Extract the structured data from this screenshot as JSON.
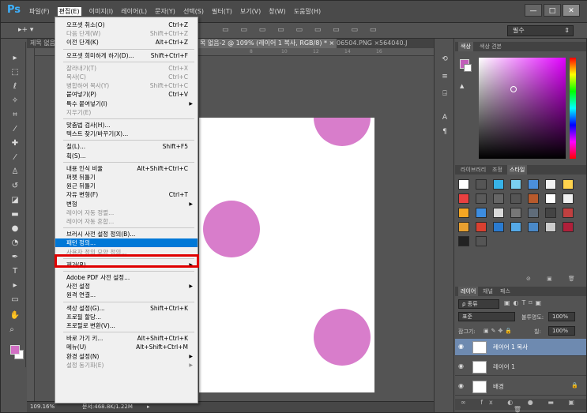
{
  "app": {
    "logo": "Ps"
  },
  "menubar": {
    "items": [
      "파일(F)",
      "편집(E)",
      "이미지(I)",
      "레이어(L)",
      "문자(Y)",
      "선택(S)",
      "필터(T)",
      "보기(V)",
      "창(W)",
      "도움말(H)"
    ],
    "active_index": 1
  },
  "window_buttons": {
    "minimize": "—",
    "maximize": "□",
    "close": "✕"
  },
  "options_bar": {
    "workspace": "필수"
  },
  "doc_tabs": [
    {
      "label": "제목 없음",
      "active": false
    },
    {
      "label": "목 없음-2 @ 109% (레이어 1 복사, RGB/8) * ×",
      "active": true
    },
    {
      "label": "06504.PNG ×",
      "active": false
    },
    {
      "label": "564040.J",
      "active": false
    }
  ],
  "ruler_ticks": [
    "8",
    "10",
    "12",
    "14",
    "16"
  ],
  "edit_menu": [
    {
      "label": "오프셋 취소(O)",
      "shortcut": "Ctrl+Z",
      "disabled": false
    },
    {
      "label": "다음 단계(W)",
      "shortcut": "Shift+Ctrl+Z",
      "disabled": true
    },
    {
      "label": "이전 단계(K)",
      "shortcut": "Alt+Ctrl+Z",
      "disabled": false
    },
    {
      "sep": true
    },
    {
      "label": "오프셋 희미하게 하기(D)...",
      "shortcut": "Shift+Ctrl+F",
      "disabled": false
    },
    {
      "sep": true
    },
    {
      "label": "잘라내기(T)",
      "shortcut": "Ctrl+X",
      "disabled": true
    },
    {
      "label": "복사(C)",
      "shortcut": "Ctrl+C",
      "disabled": true
    },
    {
      "label": "병합하여 복사(Y)",
      "shortcut": "Shift+Ctrl+C",
      "disabled": true
    },
    {
      "label": "붙여넣기(P)",
      "shortcut": "Ctrl+V",
      "disabled": false
    },
    {
      "label": "특수 붙여넣기(I)",
      "shortcut": "",
      "disabled": false,
      "submenu": true
    },
    {
      "label": "지우기(E)",
      "shortcut": "",
      "disabled": true
    },
    {
      "sep": true
    },
    {
      "label": "맞춤법 검사(H)...",
      "shortcut": "",
      "disabled": false
    },
    {
      "label": "텍스트 찾기/바꾸기(X)...",
      "shortcut": "",
      "disabled": false
    },
    {
      "sep": true
    },
    {
      "label": "칠(L)...",
      "shortcut": "Shift+F5",
      "disabled": false
    },
    {
      "label": "획(S)...",
      "shortcut": "",
      "disabled": false
    },
    {
      "sep": true
    },
    {
      "label": "내용 인식 비율",
      "shortcut": "Alt+Shift+Ctrl+C",
      "disabled": false
    },
    {
      "label": "퍼펫 뒤틀기",
      "shortcut": "",
      "disabled": false
    },
    {
      "label": "원근 뒤틀기",
      "shortcut": "",
      "disabled": false
    },
    {
      "label": "자유 변형(F)",
      "shortcut": "Ctrl+T",
      "disabled": false
    },
    {
      "label": "변형",
      "shortcut": "",
      "disabled": false,
      "submenu": true
    },
    {
      "label": "레이어 자동 정렬...",
      "shortcut": "",
      "disabled": true
    },
    {
      "label": "레이어 자동 혼합...",
      "shortcut": "",
      "disabled": true
    },
    {
      "sep": true
    },
    {
      "label": "브러시 사전 설정 정의(B)...",
      "shortcut": "",
      "disabled": false
    },
    {
      "label": "패턴 정의...",
      "shortcut": "",
      "disabled": false,
      "highlight": true
    },
    {
      "label": "사용자 정의 모양 정의...",
      "shortcut": "",
      "disabled": true
    },
    {
      "sep": true
    },
    {
      "label": "제거(R)",
      "shortcut": "",
      "disabled": false,
      "submenu": true
    },
    {
      "sep": true
    },
    {
      "label": "Adobe PDF 사전 설정...",
      "shortcut": "",
      "disabled": false
    },
    {
      "label": "사전 설정",
      "shortcut": "",
      "disabled": false,
      "submenu": true
    },
    {
      "label": "원격 연결...",
      "shortcut": "",
      "disabled": false
    },
    {
      "sep": true
    },
    {
      "label": "색상 설정(G)...",
      "shortcut": "Shift+Ctrl+K",
      "disabled": false
    },
    {
      "label": "프로필 할당...",
      "shortcut": "",
      "disabled": false
    },
    {
      "label": "프로필로 변환(V)...",
      "shortcut": "",
      "disabled": false
    },
    {
      "sep": true
    },
    {
      "label": "바로 가기 키...",
      "shortcut": "Alt+Shift+Ctrl+K",
      "disabled": false
    },
    {
      "label": "메뉴(U)",
      "shortcut": "Alt+Shift+Ctrl+M",
      "disabled": false
    },
    {
      "label": "환경 설정(N)",
      "shortcut": "",
      "disabled": false,
      "submenu": true
    },
    {
      "label": "설정 동기화(E)",
      "shortcut": "",
      "disabled": true,
      "submenu": true
    }
  ],
  "status": {
    "zoom": "109.16%",
    "doc_info": "문서:468.8K/1.22M"
  },
  "color_panel": {
    "tabs": [
      "색상",
      "색상 견본"
    ],
    "fg_color": "#c15fb9"
  },
  "styles_panel": {
    "tabs": [
      "라이브러리",
      "조정",
      "스타일"
    ],
    "swatches": [
      "#fff",
      "#555",
      "#37b3e8",
      "#7ad0f0",
      "#4b8fdb",
      "#f2f2f2",
      "#ffd34d",
      "#e94040",
      "#5a5a5a",
      "#666",
      "#555",
      "#b85a2c",
      "#ffffff",
      "#f0f0f0",
      "#f5a623",
      "#3d8de0",
      "#d9d9d9",
      "#777",
      "#5f6c7a",
      "#444",
      "#c04040",
      "#e8a030",
      "#d94030",
      "#2a7bd0",
      "#55aae8",
      "#4a89c8",
      "#ccc",
      "#b0203a",
      "#222",
      "#555"
    ]
  },
  "layers_panel": {
    "tabs": [
      "레이어",
      "채널",
      "패스"
    ],
    "filter": "ρ 종류",
    "blend_mode": "표준",
    "opacity_label": "불투명도:",
    "opacity": "100%",
    "lock_label": "잠그기:",
    "fill_label": "칠:",
    "fill": "100%",
    "layers": [
      {
        "name": "레이어 1 복사",
        "selected": true
      },
      {
        "name": "레이어 1",
        "selected": false
      },
      {
        "name": "배경",
        "selected": false,
        "locked": true
      }
    ],
    "footer_icons": "∞ fx ◐ ● ▬ ▣ 🗑"
  }
}
